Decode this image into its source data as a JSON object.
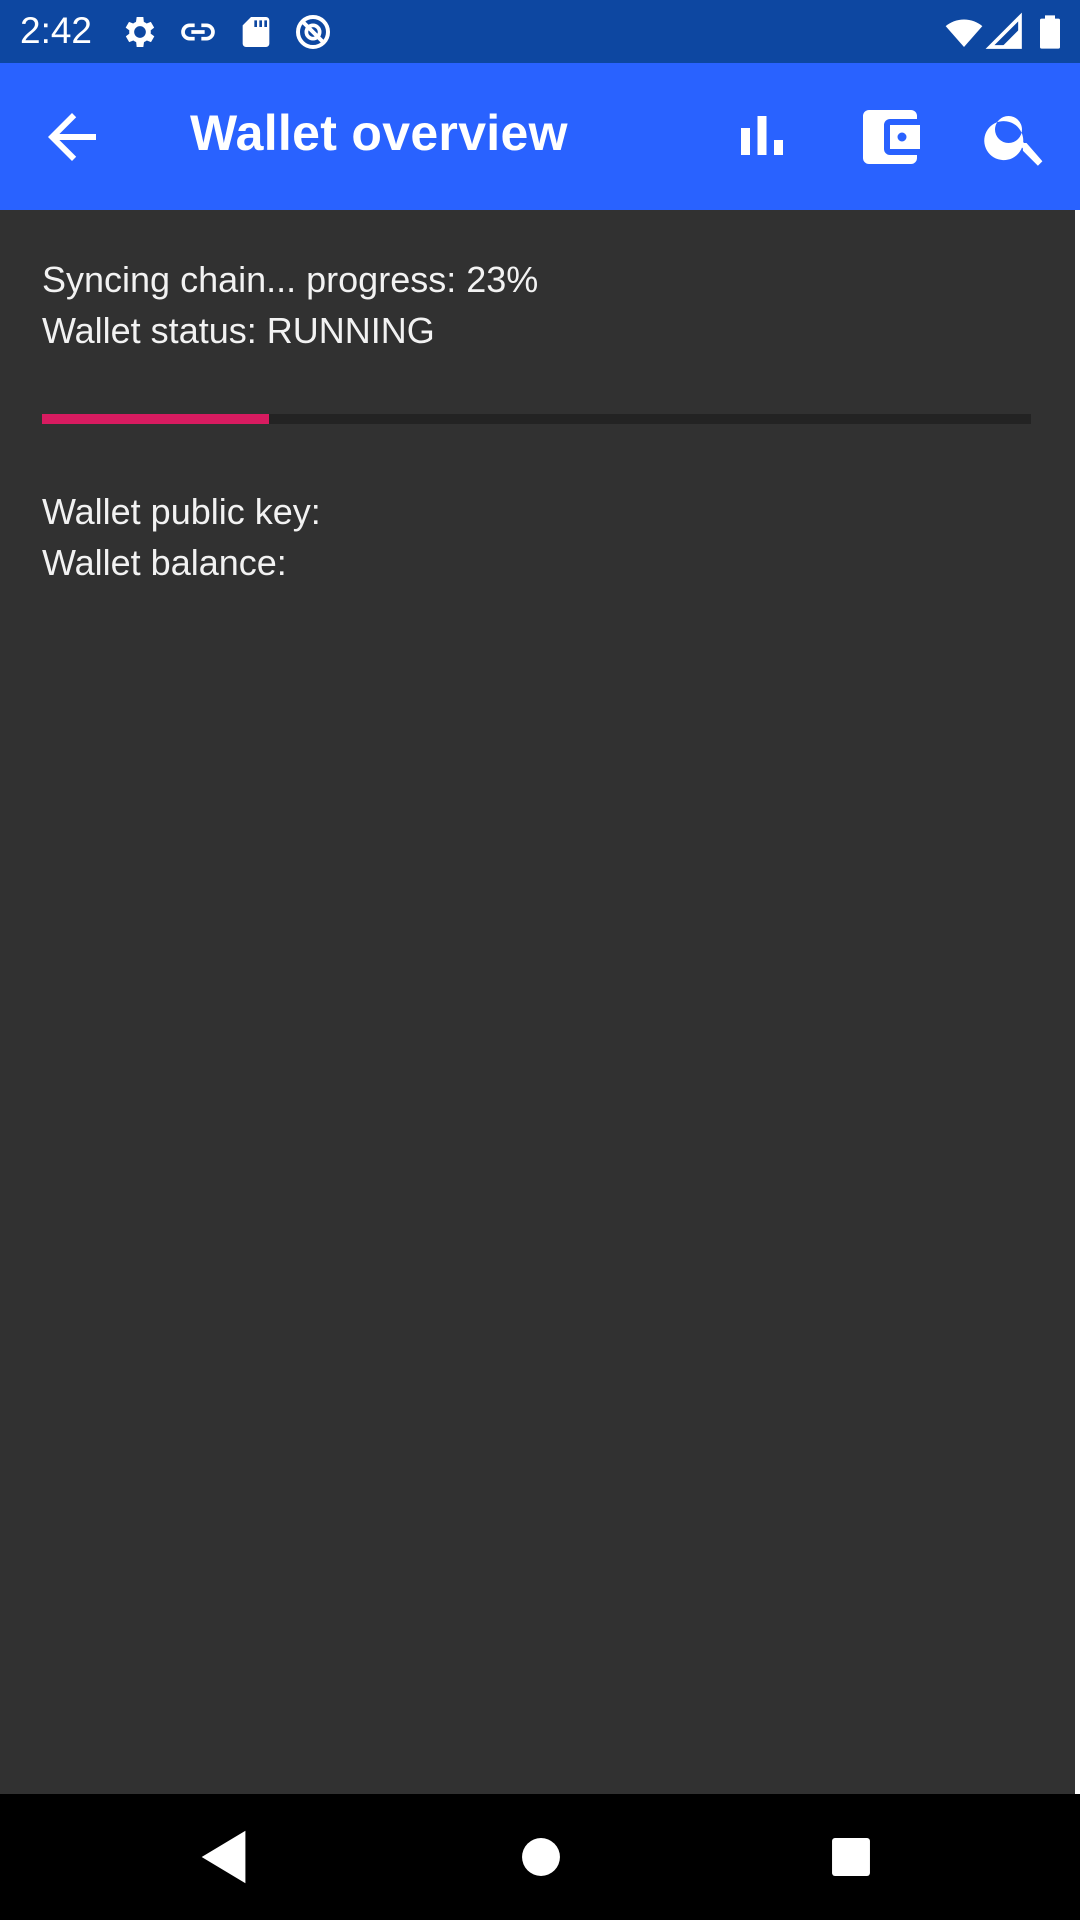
{
  "status_bar": {
    "time": "2:42",
    "left_icons": [
      "gear-icon",
      "link-icon",
      "sd-card-icon",
      "vpn-blocked-icon"
    ],
    "right_icons": [
      "wifi-icon",
      "cellular-signal-icon",
      "battery-icon"
    ]
  },
  "app_bar": {
    "title": "Wallet overview",
    "back_icon": "arrow-back-icon",
    "actions": [
      "bar-chart-icon",
      "wallet-icon",
      "search-icon"
    ],
    "color": "#2962ff"
  },
  "sync": {
    "progress_text": "Syncing chain... progress: 23%",
    "progress_value": 0.23,
    "status_text": "Wallet status: RUNNING",
    "progress_color": "#d81b60"
  },
  "wallet": {
    "public_key_label": "Wallet public key:",
    "balance_label": "Wallet balance:"
  },
  "nav_bar": {
    "icons": [
      "back-triangle-icon",
      "home-circle-icon",
      "recents-square-icon"
    ]
  }
}
